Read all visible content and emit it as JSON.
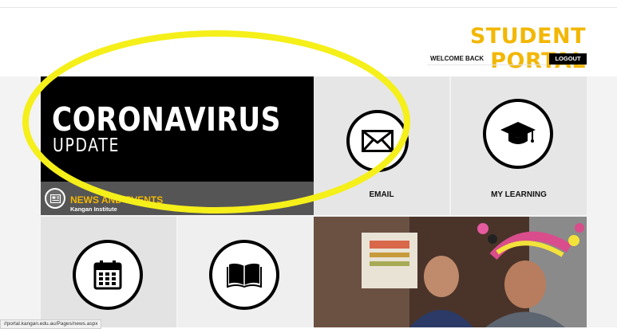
{
  "header": {
    "title": "STUDENT PORTAL",
    "welcome_text": "WELCOME BACK",
    "logout_label": "LOGOUT"
  },
  "banner": {
    "line1": "CORONAVIRUS",
    "line2": "UPDATE"
  },
  "news": {
    "title": "NEWS AND EVENTS",
    "subtitle": "Kangan Institute",
    "arrow": "›"
  },
  "tiles": {
    "email_label": "EMAIL",
    "learning_label": "MY LEARNING"
  },
  "status_bar": {
    "url": "//portal.kangan.edu.au/Pages/news.aspx"
  },
  "colors": {
    "brand_yellow": "#f2b705",
    "highlight_yellow": "#f5ef1a",
    "tile_grey": "#e6e6e6",
    "news_grey": "#555555"
  },
  "icons": [
    "envelope-icon",
    "graduation-cap-icon",
    "calendar-icon",
    "book-icon",
    "newspaper-icon",
    "chevron-right-icon"
  ]
}
